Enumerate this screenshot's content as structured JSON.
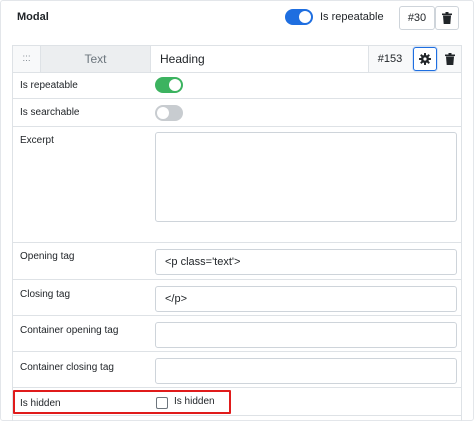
{
  "header": {
    "title": "Modal",
    "repeatable_label": "Is repeatable",
    "repeatable_on": true,
    "id": "#30"
  },
  "field": {
    "drag_glyph": ":::",
    "type": "Text",
    "name": "Heading",
    "id": "#153"
  },
  "settings": {
    "is_repeatable": {
      "label": "Is repeatable",
      "on": true
    },
    "is_searchable": {
      "label": "Is searchable",
      "on": false
    },
    "excerpt": {
      "label": "Excerpt",
      "value": ""
    },
    "opening_tag": {
      "label": "Opening tag",
      "value": "<p class='text'>"
    },
    "closing_tag": {
      "label": "Closing tag",
      "value": "</p>"
    },
    "container_opening_tag": {
      "label": "Container opening tag",
      "value": ""
    },
    "container_closing_tag": {
      "label": "Container closing tag",
      "value": ""
    },
    "is_hidden": {
      "label": "Is hidden",
      "checkbox_label": "Is hidden",
      "checked": false
    }
  },
  "colors": {
    "toggle_blue": "#1e6ee0",
    "toggle_green": "#3cb360",
    "toggle_off": "#c8ccd0",
    "highlight_red": "#e01b1b"
  },
  "icons": [
    "trash-icon",
    "gear-icon",
    "drag-handle-icon"
  ]
}
